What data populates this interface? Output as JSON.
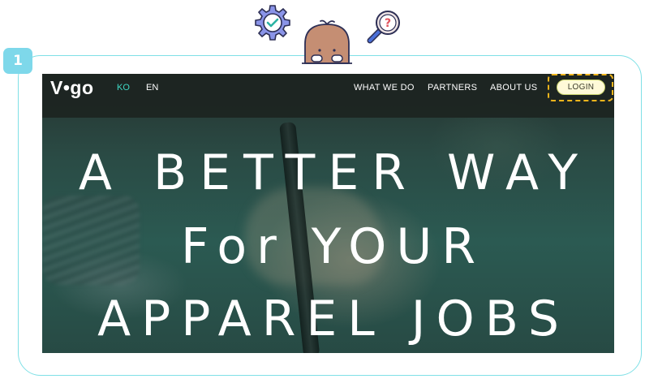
{
  "step_number": "1",
  "nav": {
    "logo": "V•go",
    "languages": [
      "KO",
      "EN"
    ],
    "links": [
      "WHAT WE DO",
      "PARTNERS",
      "ABOUT US"
    ],
    "login_label": "LOGIN"
  },
  "hero": {
    "line1": "A BETTER WAY",
    "line2": "For YOUR",
    "line3": "APPAREL JOBS"
  },
  "icons": {
    "gear": "gear-check-icon",
    "mascot": "mascot-icon",
    "magnifier": "magnifier-question-icon"
  },
  "colors": {
    "active_language": "#3fd8c4",
    "highlight": "#f1b51c",
    "frame": "#7fe0e6"
  }
}
